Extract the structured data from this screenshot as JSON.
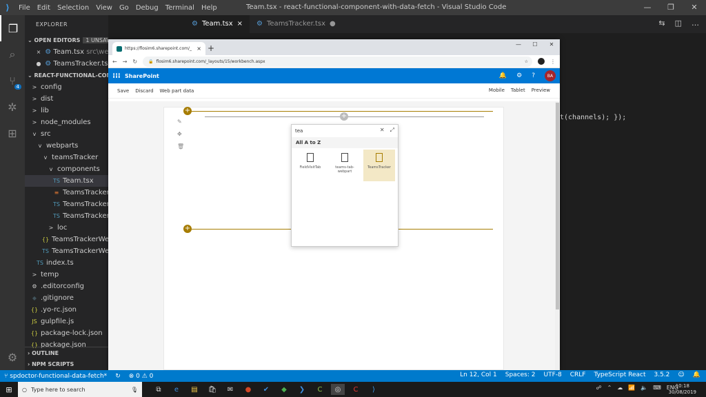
{
  "vscode": {
    "menu": [
      "File",
      "Edit",
      "Selection",
      "View",
      "Go",
      "Debug",
      "Terminal",
      "Help"
    ],
    "window_title": "Team.tsx - react-functional-component-with-data-fetch - Visual Studio Code",
    "tabs": [
      {
        "label": "Team.tsx",
        "close": "×"
      },
      {
        "label": "TeamsTracker.tsx",
        "close": "●"
      }
    ],
    "scm_badge": "4",
    "explorer": {
      "title": "EXPLORER",
      "open_editors": "OPEN EDITORS",
      "unsaved": "1 UNSAVED",
      "open_files": [
        {
          "name": "Team.tsx",
          "path": "src\\webpa"
        },
        {
          "name": "TeamsTracker.tsx",
          "path": ""
        }
      ],
      "project": "REACT-FUNCTIONAL-COM",
      "tree": [
        {
          "label": "config",
          "icon": ">",
          "indent": 1
        },
        {
          "label": "dist",
          "icon": ">",
          "indent": 1
        },
        {
          "label": "lib",
          "icon": ">",
          "indent": 1
        },
        {
          "label": "node_modules",
          "icon": ">",
          "indent": 1
        },
        {
          "label": "src",
          "icon": "v",
          "indent": 1
        },
        {
          "label": "webparts",
          "icon": "v",
          "indent": 2
        },
        {
          "label": "teamsTracker",
          "icon": "v",
          "indent": 3
        },
        {
          "label": "components",
          "icon": "v",
          "indent": 4
        },
        {
          "label": "Team.tsx",
          "icon": "TS",
          "indent": 5,
          "selected": true
        },
        {
          "label": "TeamsTracker.m",
          "icon": "≡",
          "indent": 5
        },
        {
          "label": "TeamsTracker.m",
          "icon": "TS",
          "indent": 5
        },
        {
          "label": "TeamsTracker.tsx",
          "icon": "TS",
          "indent": 5
        },
        {
          "label": "loc",
          "icon": ">",
          "indent": 4
        },
        {
          "label": "TeamsTrackerWeb",
          "icon": "{}",
          "indent": 3
        },
        {
          "label": "TeamsTrackerWeb",
          "icon": "TS",
          "indent": 3
        },
        {
          "label": "index.ts",
          "icon": "TS",
          "indent": 2
        },
        {
          "label": "temp",
          "icon": ">",
          "indent": 1
        },
        {
          "label": ".editorconfig",
          "icon": "⚙",
          "indent": 1
        },
        {
          "label": ".gitignore",
          "icon": "◆",
          "indent": 1
        },
        {
          "label": ".yo-rc.json",
          "icon": "{}",
          "indent": 1
        },
        {
          "label": "gulpfile.js",
          "icon": "JS",
          "indent": 1
        },
        {
          "label": "package-lock.json",
          "icon": "{}",
          "indent": 1
        },
        {
          "label": "package.json",
          "icon": "{}",
          "indent": 1
        }
      ],
      "outline": "OUTLINE",
      "npm_scripts": "NPM SCRIPTS"
    },
    "code_line": "t(channels); });",
    "status": {
      "branch": "spdoctor-functional-data-fetch*",
      "errors": "0",
      "warnings": "0",
      "position": "Ln 12, Col 1",
      "spaces": "Spaces: 2",
      "encoding": "UTF-8",
      "eol": "CRLF",
      "language": "TypeScript React",
      "version": "3.5.2"
    }
  },
  "browser": {
    "tab_title": "https://flosim6.sharepoint.com/_",
    "url": "flosim6.sharepoint.com/_layouts/15/workbench.aspx",
    "sharepoint": {
      "brand": "SharePoint",
      "avatar": "BA",
      "commands_left": [
        "Save",
        "Discard",
        "Web part data"
      ],
      "commands_right": [
        "Mobile",
        "Tablet",
        "Preview"
      ],
      "picker": {
        "search_value": "tea",
        "category": "All A to Z",
        "items": [
          {
            "label": "FieldVisitTab",
            "selected": false
          },
          {
            "label": "teams-tab-webpart",
            "selected": false
          },
          {
            "label": "TeamsTracker",
            "selected": true
          }
        ]
      }
    }
  },
  "taskbar": {
    "search_placeholder": "Type here to search",
    "lang": "ENG",
    "time": "10:18",
    "date": "30/08/2019"
  }
}
